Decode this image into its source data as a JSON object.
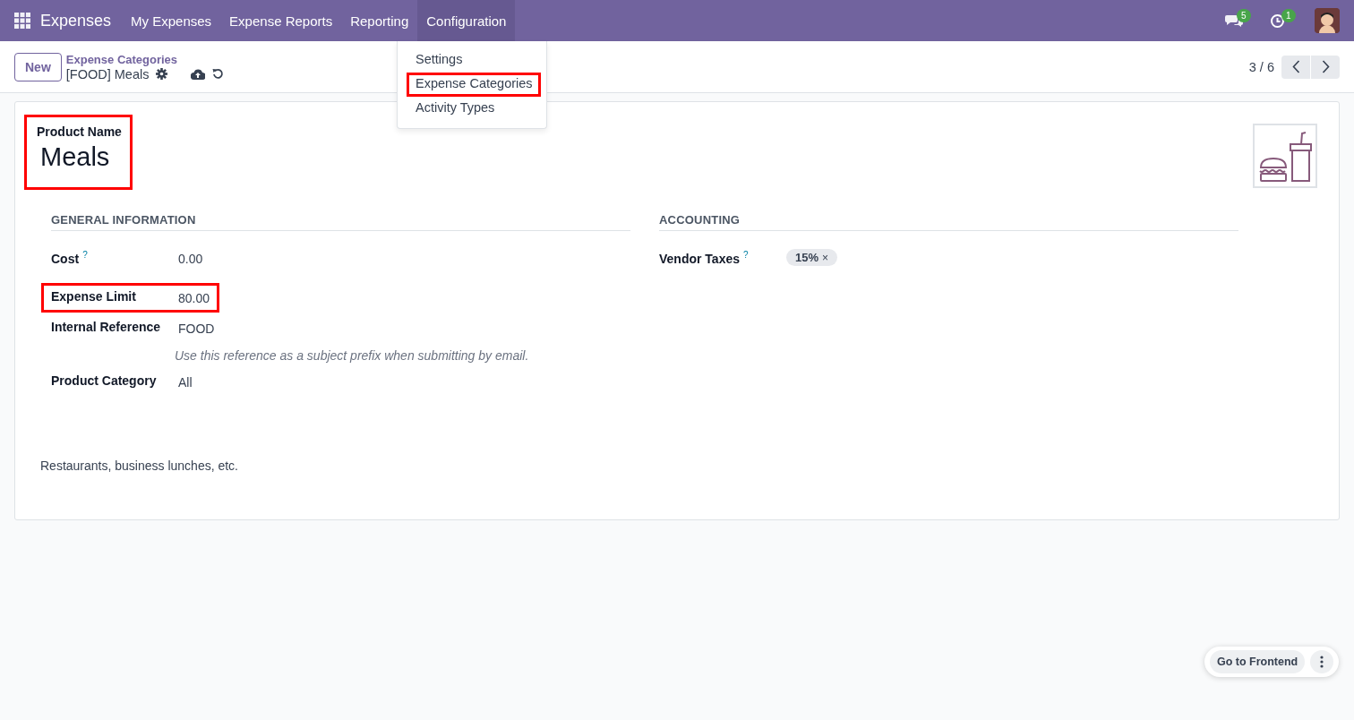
{
  "navbar": {
    "app_name": "Expenses",
    "menu": [
      {
        "label": "My Expenses",
        "selected": false
      },
      {
        "label": "Expense Reports",
        "selected": false
      },
      {
        "label": "Reporting",
        "selected": false
      },
      {
        "label": "Configuration",
        "selected": true
      }
    ],
    "messages_badge": "5",
    "activities_badge": "1"
  },
  "dropdown": {
    "items": [
      {
        "label": "Settings",
        "highlighted": false
      },
      {
        "label": "Expense Categories",
        "highlighted": true
      },
      {
        "label": "Activity Types",
        "highlighted": false
      }
    ]
  },
  "control_panel": {
    "new_button": "New",
    "breadcrumb": "Expense Categories",
    "record_title": "[FOOD] Meals",
    "pager": "3 / 6"
  },
  "form": {
    "name_label": "Product Name",
    "name": "Meals",
    "name_highlighted": true,
    "sections": [
      {
        "title": "GENERAL INFORMATION",
        "fields": [
          {
            "label": "Cost",
            "help": "?",
            "value": "0.00",
            "highlighted": false
          },
          {
            "label": "Expense Limit",
            "value": "80.00",
            "highlighted": true
          },
          {
            "label": "Internal Reference",
            "value": "FOOD",
            "hint": "Use this reference as a subject prefix when submitting by email.",
            "highlighted": false
          },
          {
            "label": "Product Category",
            "value": "All",
            "highlighted": false
          }
        ]
      },
      {
        "title": "ACCOUNTING",
        "fields": [
          {
            "label": "Vendor Taxes",
            "help": "?",
            "tags": [
              {
                "label": "15%",
                "remove": "×"
              }
            ],
            "highlighted": false
          }
        ]
      }
    ],
    "description": "Restaurants, business lunches, etc."
  },
  "floating": {
    "button": "Go to Frontend"
  }
}
